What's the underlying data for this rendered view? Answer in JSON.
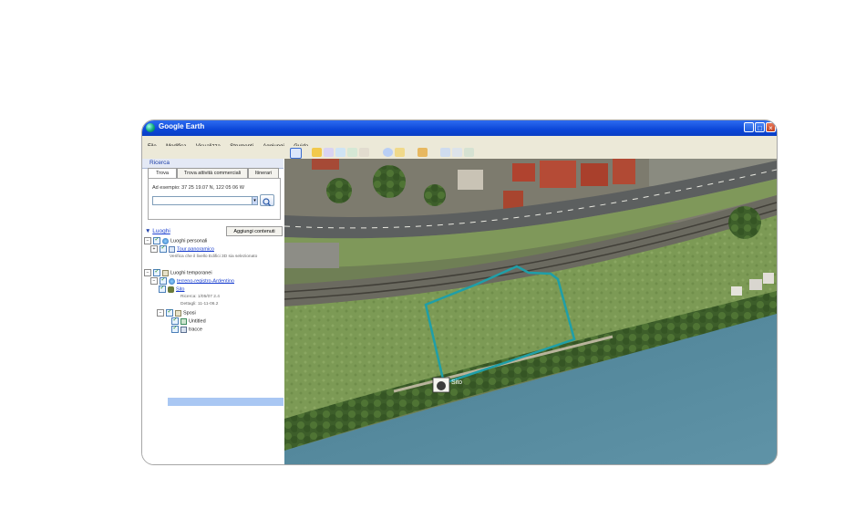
{
  "window": {
    "title": "Google Earth",
    "minimize_glyph": "_",
    "maximize_glyph": "□",
    "close_glyph": "×"
  },
  "menu": [
    "File",
    "Modifica",
    "Visualizza",
    "Strumenti",
    "Aggiungi",
    "Guida"
  ],
  "search": {
    "header": "Ricerca",
    "tabs": [
      "Trova",
      "Trova attività commerciali",
      "Itinerari"
    ],
    "label": "Ad esempio: 37 25 19.07 N, 122 05 06 W",
    "input_value": "",
    "dropdown_glyph": "▾",
    "go_glyph": "🔍"
  },
  "places": {
    "header": "Luoghi",
    "add_button": "Aggiungi contenuti",
    "tree": [
      {
        "label": "Luoghi personali",
        "link": false
      },
      {
        "label": "Tour panoramico",
        "link": true
      },
      {
        "label": "Verifica che il livello Edifici 3D sia selezionato",
        "link": false,
        "sub": true
      },
      {
        "label": "Luoghi temporanei",
        "link": false
      },
      {
        "label": "terreno-registro-Ardentino",
        "link": true
      },
      {
        "label": "Sito",
        "link": true
      },
      {
        "label": "Ricerca: 1/05/07 2.4",
        "link": false,
        "sub": true
      },
      {
        "label": "Dettagli: 11-11-06.2",
        "link": false,
        "sub": true
      },
      {
        "label": "Sposi",
        "link": false
      },
      {
        "label": "Untitled",
        "link": false
      },
      {
        "label": "tracce",
        "link": false
      }
    ]
  },
  "map": {
    "placemark_label": "Sito",
    "polygon_color": "#1f9fa8"
  },
  "colors": {
    "titlebar": "#0b46d8",
    "link": "#1a3fcf",
    "selection": "#a9c7f3"
  }
}
